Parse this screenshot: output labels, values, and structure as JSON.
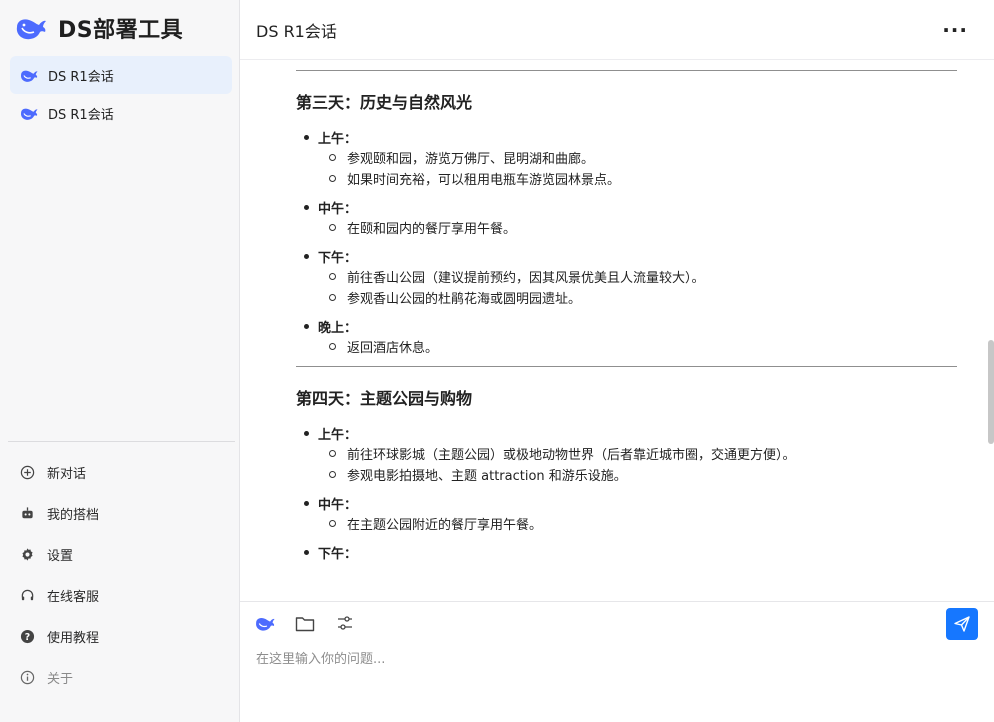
{
  "app": {
    "title": "DS部署工具"
  },
  "sidebar": {
    "sessions": [
      {
        "label": "DS R1会话",
        "active": true
      },
      {
        "label": "DS R1会话",
        "active": false
      }
    ],
    "menu": [
      {
        "label": "新对话",
        "icon": "plus-circle-icon"
      },
      {
        "label": "我的搭档",
        "icon": "robot-icon"
      },
      {
        "label": "设置",
        "icon": "gear-icon"
      },
      {
        "label": "在线客服",
        "icon": "headset-icon"
      },
      {
        "label": "使用教程",
        "icon": "question-icon"
      },
      {
        "label": "关于",
        "icon": "info-icon"
      }
    ]
  },
  "header": {
    "title": "DS R1会话",
    "more": "···"
  },
  "content": {
    "day3": {
      "title": "第三天：历史与自然风光",
      "morning_label": "上午：",
      "morning_1": "参观颐和园，游览万佛厅、昆明湖和曲廊。",
      "morning_2": "如果时间充裕，可以租用电瓶车游览园林景点。",
      "noon_label": "中午：",
      "noon_1": "在颐和园内的餐厅享用午餐。",
      "afternoon_label": "下午：",
      "afternoon_1": "前往香山公园（建议提前预约，因其风景优美且人流量较大）。",
      "afternoon_2": "参观香山公园的杜鹃花海或圆明园遗址。",
      "evening_label": "晚上：",
      "evening_1": "返回酒店休息。"
    },
    "day4": {
      "title": "第四天：主题公园与购物",
      "morning_label": "上午：",
      "morning_1": "前往环球影城（主题公园）或极地动物世界（后者靠近城市圈，交通更方便）。",
      "morning_2": "参观电影拍摄地、主题 attraction 和游乐设施。",
      "noon_label": "中午：",
      "noon_1": "在主题公园附近的餐厅享用午餐。",
      "afternoon_label": "下午："
    }
  },
  "composer": {
    "placeholder": "在这里输入你的问题..."
  },
  "colors": {
    "accent": "#1677ff",
    "active_session_bg": "#e8f0fc",
    "whale": "#4d6bfe"
  }
}
